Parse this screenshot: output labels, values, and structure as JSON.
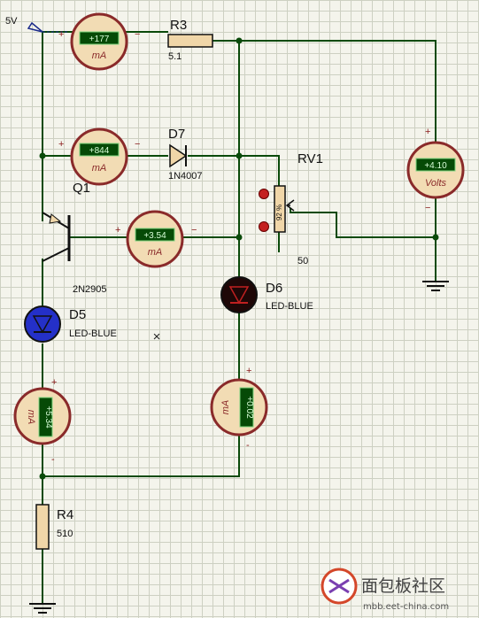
{
  "power": {
    "label": "5V"
  },
  "meters": {
    "r3_meter": {
      "value": "+177",
      "unit": "mA"
    },
    "d7_meter": {
      "value": "+844",
      "unit": "mA"
    },
    "q1_meter": {
      "value": "+3.54",
      "unit": "mA"
    },
    "volt_meter": {
      "value": "+4.10",
      "unit": "Volts"
    },
    "d5_meter": {
      "value": "+5.34",
      "unit": "mA"
    },
    "d6_meter": {
      "value": "+0.02",
      "unit": "mA"
    }
  },
  "components": {
    "r3": {
      "ref": "R3",
      "value": "5.1"
    },
    "d7": {
      "ref": "D7",
      "value": "1N4007"
    },
    "rv1": {
      "ref": "RV1",
      "value": "50",
      "wiper": "92 %"
    },
    "q1": {
      "ref": "Q1",
      "value": "2N2905"
    },
    "d5": {
      "ref": "D5",
      "value": "LED-BLUE"
    },
    "d6": {
      "ref": "D6",
      "value": "LED-BLUE"
    },
    "r4": {
      "ref": "R4",
      "value": "510"
    }
  },
  "polarity": {
    "plus": "+",
    "minus": "−",
    "minus_short": "-"
  },
  "marker": {
    "glyph": "×"
  },
  "watermark": {
    "text": "面包板社区",
    "url": "mbb.eet-china.com"
  }
}
